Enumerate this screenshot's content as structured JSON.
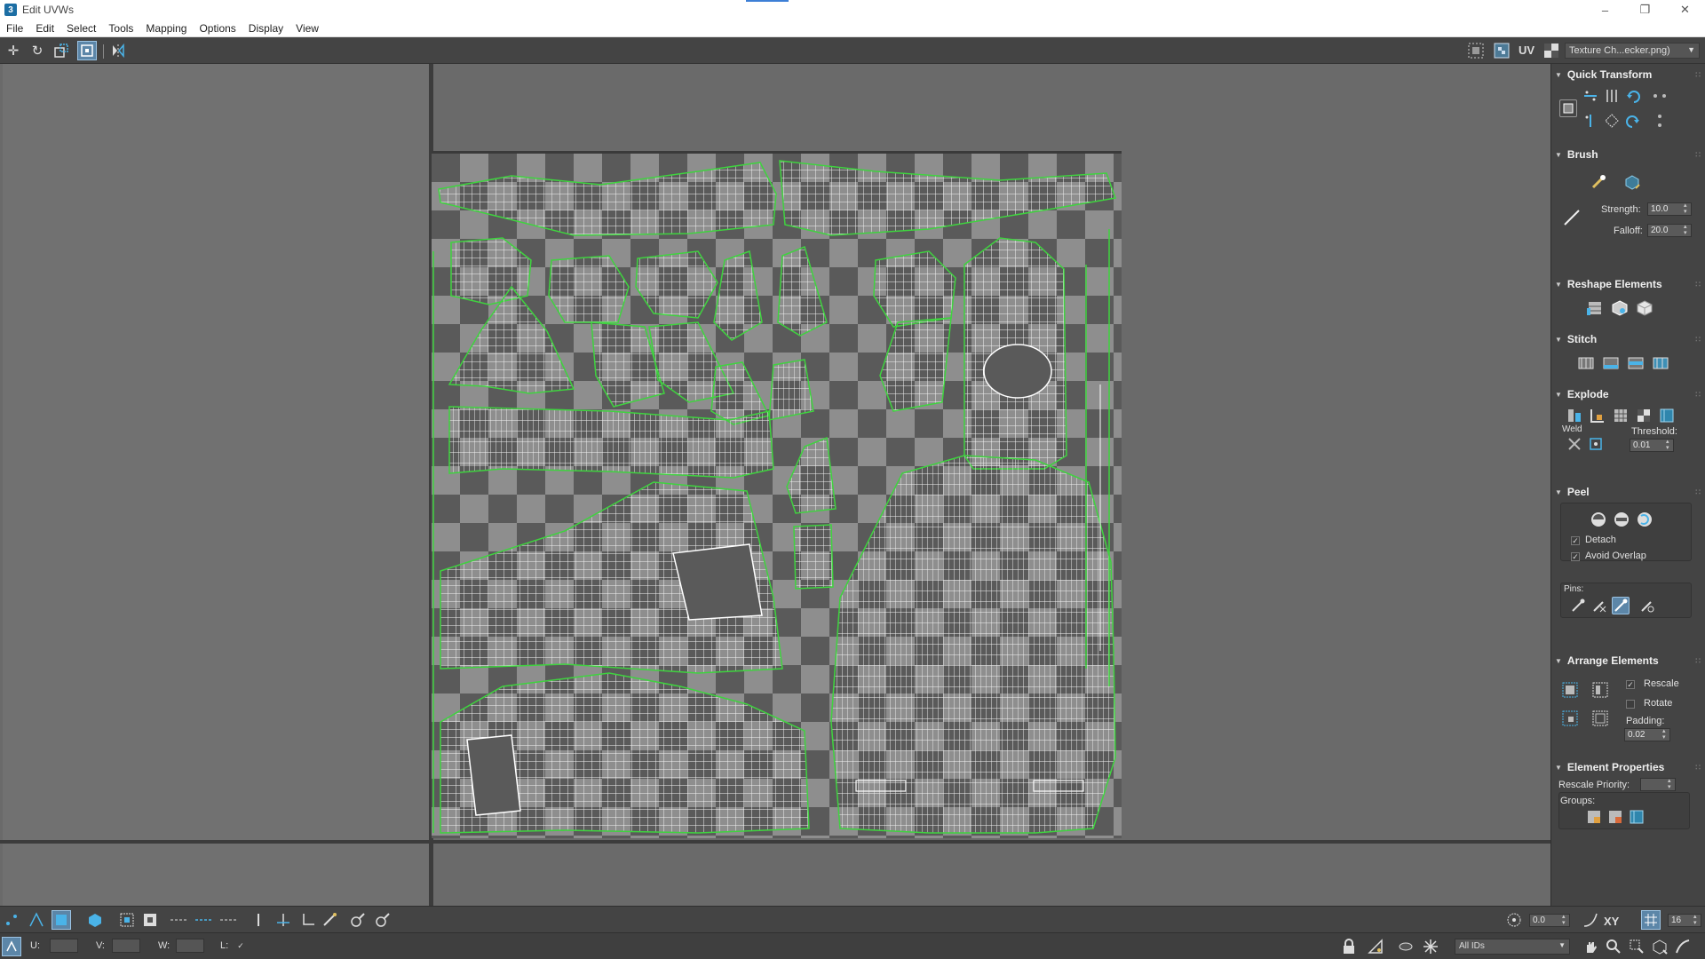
{
  "window": {
    "title": "Edit UVWs",
    "app_icon": "3"
  },
  "menu": [
    "File",
    "Edit",
    "Select",
    "Tools",
    "Mapping",
    "Options",
    "Display",
    "View"
  ],
  "toolbar": {
    "uv_label": "UV",
    "texture": "Texture Ch...ecker.png)"
  },
  "panel": {
    "quick_transform": {
      "title": "Quick Transform"
    },
    "brush": {
      "title": "Brush",
      "strength_label": "Strength:",
      "strength_value": "10.0",
      "falloff_label": "Falloff:",
      "falloff_value": "20.0"
    },
    "reshape": {
      "title": "Reshape Elements"
    },
    "stitch": {
      "title": "Stitch"
    },
    "explode": {
      "title": "Explode",
      "weld_label": "Weld",
      "threshold_label": "Threshold:",
      "threshold_value": "0.01"
    },
    "peel": {
      "title": "Peel",
      "detach_label": "Detach",
      "detach_checked": true,
      "avoid_overlap_label": "Avoid Overlap",
      "avoid_overlap_checked": true,
      "pins_label": "Pins:"
    },
    "arrange": {
      "title": "Arrange Elements",
      "rescale_label": "Rescale",
      "rescale_checked": true,
      "rotate_label": "Rotate",
      "rotate_checked": false,
      "padding_label": "Padding:",
      "padding_value": "0.02"
    },
    "element_props": {
      "title": "Element Properties",
      "rescale_priority_label": "Rescale Priority:",
      "groups_label": "Groups:"
    }
  },
  "status": {
    "u_label": "U:",
    "v_label": "V:",
    "w_label": "W:",
    "l_label": "L:",
    "angle_value": "0.0",
    "xy_label": "XY",
    "grid_value": "16",
    "ids_value": "All IDs"
  },
  "colors": {
    "panel_bg": "#444444",
    "viewport_bg": "#6a6a6a",
    "uv_edge": "#ffffff",
    "uv_border": "#3fd33f",
    "accent_blue": "#4ab3e8"
  }
}
